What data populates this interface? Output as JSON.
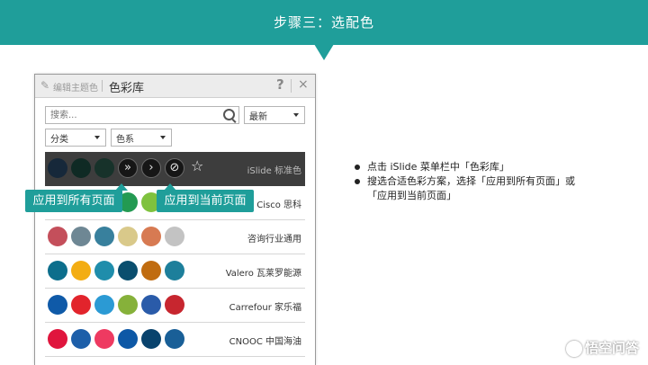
{
  "header": {
    "title": "步骤三：选配色",
    "color": "#1f9e9a"
  },
  "panel": {
    "tab_edit": "编辑主题色",
    "tab_library": "色彩库",
    "help_glyph": "?",
    "close_glyph": "×",
    "search_placeholder": "搜索...",
    "sort_value": "最新",
    "filter_category": "分类",
    "filter_color": "色系"
  },
  "palettes": [
    {
      "name": "iSlide 标准色",
      "colors": [
        "#16283a",
        "#0f2a24",
        "#17322a"
      ],
      "active": true
    },
    {
      "name": "Cisco 思科",
      "colors": [
        "#1c5d8a",
        "#2389c9",
        "#27a0d8",
        "#239a52",
        "#7fc23e"
      ]
    },
    {
      "name": "咨询行业通用",
      "colors": [
        "#c44f5b",
        "#6e8794",
        "#38809d",
        "#d9c98a",
        "#d77a52",
        "#c3c3c3"
      ]
    },
    {
      "name": "Valero 瓦莱罗能源",
      "colors": [
        "#0c6e8c",
        "#f3ad13",
        "#1f8dab",
        "#0a4e6e",
        "#c06c10",
        "#1d7f9b"
      ]
    },
    {
      "name": "Carrefour 家乐福",
      "colors": [
        "#0f5aa8",
        "#e2242c",
        "#2b9ad4",
        "#86b13a",
        "#2a5ba9",
        "#c7262f"
      ]
    },
    {
      "name": "CNOOC 中国海油",
      "colors": [
        "#e0153d",
        "#1d5fa9",
        "#ee3a61",
        "#0d58a6",
        "#09436d",
        "#195f97"
      ]
    }
  ],
  "actions": {
    "apply_all_glyph": "»",
    "apply_current_glyph": "›",
    "link_glyph": "⊘",
    "star_glyph": "☆"
  },
  "callouts": {
    "apply_all": "应用到所有页面",
    "apply_current": "应用到当前页面"
  },
  "instructions": {
    "line1": "点击 iSlide 菜单栏中「色彩库」",
    "line2a": "搜选合适色彩方案，选择「应用到所有页面」或",
    "line2b": "「应用到当前页面」"
  },
  "watermark": "悟空问答"
}
